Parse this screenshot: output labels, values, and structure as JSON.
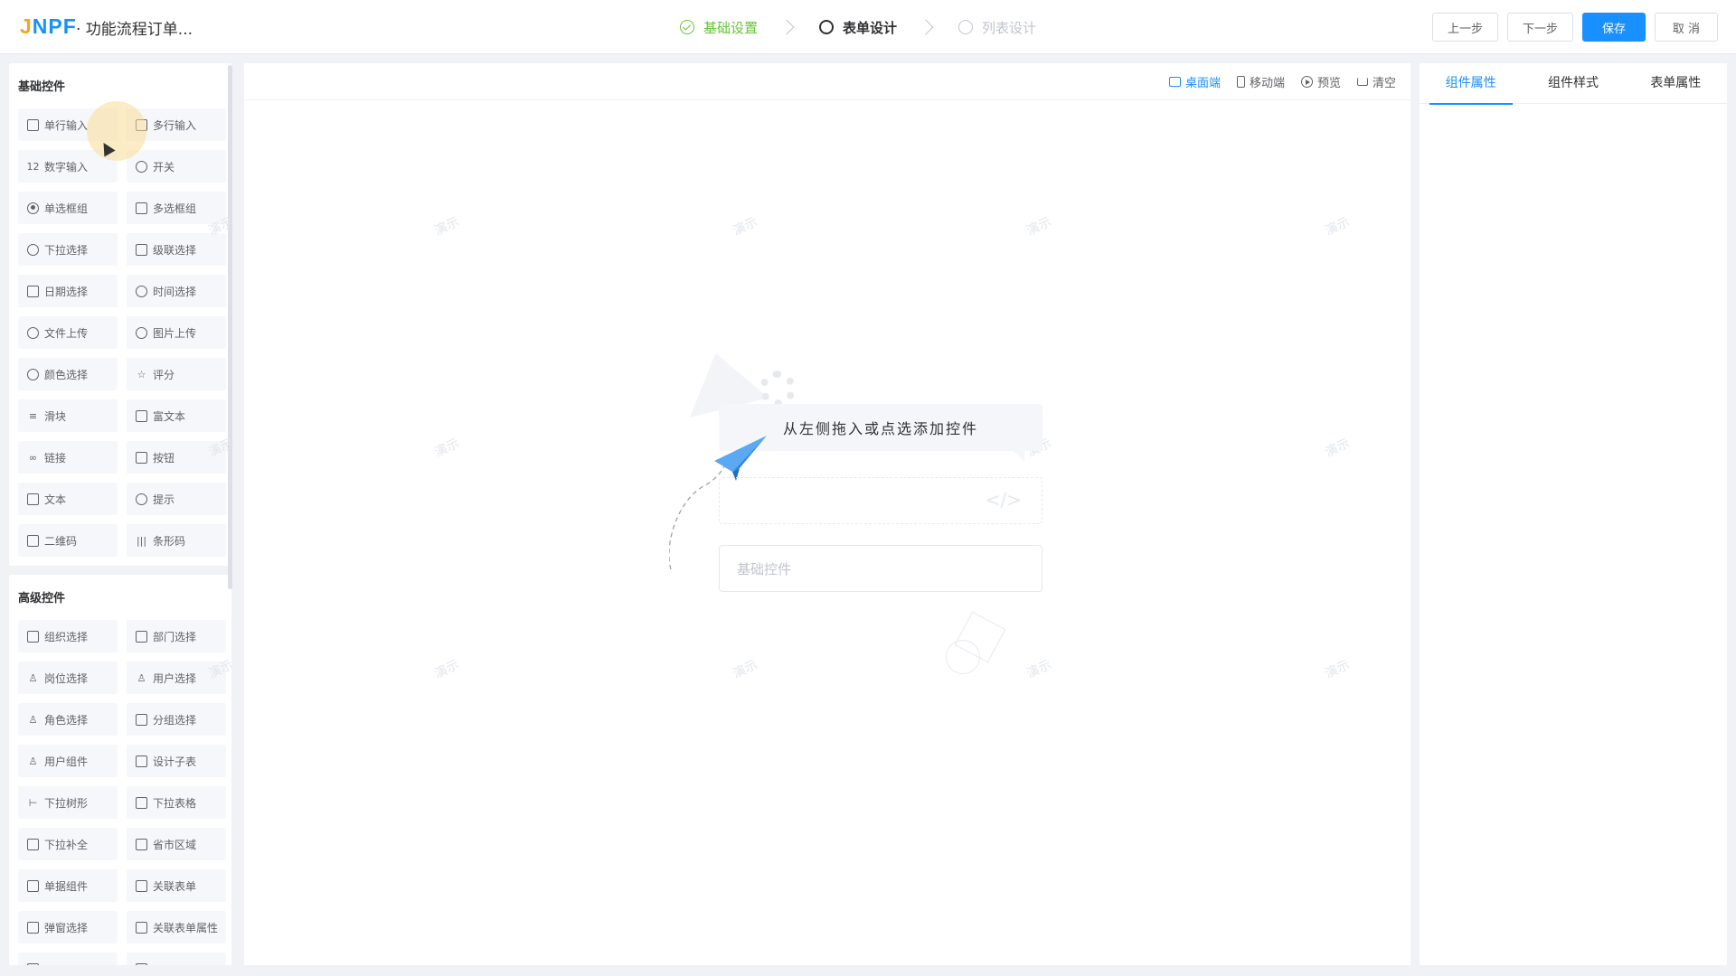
{
  "header": {
    "logo_a": "J",
    "logo_b": "NPF",
    "title": "· 功能流程订单...",
    "steps": [
      {
        "label": "基础设置",
        "state": "done"
      },
      {
        "label": "表单设计",
        "state": "active"
      },
      {
        "label": "列表设计",
        "state": "todo"
      }
    ],
    "buttons": {
      "prev": "上一步",
      "next": "下一步",
      "save": "保存",
      "cancel": "取 消"
    }
  },
  "basic": {
    "title": "基础控件",
    "items": [
      {
        "label": "单行输入",
        "icon": "input-icon"
      },
      {
        "label": "多行输入",
        "icon": "textarea-icon"
      },
      {
        "label": "数字输入",
        "icon": "number-icon"
      },
      {
        "label": "开关",
        "icon": "switch-icon"
      },
      {
        "label": "单选框组",
        "icon": "radio-icon"
      },
      {
        "label": "多选框组",
        "icon": "checkbox-icon"
      },
      {
        "label": "下拉选择",
        "icon": "select-icon"
      },
      {
        "label": "级联选择",
        "icon": "cascader-icon"
      },
      {
        "label": "日期选择",
        "icon": "calendar-icon"
      },
      {
        "label": "时间选择",
        "icon": "clock-icon"
      },
      {
        "label": "文件上传",
        "icon": "upload-icon"
      },
      {
        "label": "图片上传",
        "icon": "image-upload-icon"
      },
      {
        "label": "颜色选择",
        "icon": "palette-icon"
      },
      {
        "label": "评分",
        "icon": "star-icon"
      },
      {
        "label": "滑块",
        "icon": "slider-icon"
      },
      {
        "label": "富文本",
        "icon": "richtext-icon"
      },
      {
        "label": "链接",
        "icon": "link-icon"
      },
      {
        "label": "按钮",
        "icon": "button-icon"
      },
      {
        "label": "文本",
        "icon": "text-icon"
      },
      {
        "label": "提示",
        "icon": "info-icon"
      },
      {
        "label": "二维码",
        "icon": "qrcode-icon"
      },
      {
        "label": "条形码",
        "icon": "barcode-icon"
      }
    ]
  },
  "advanced": {
    "title": "高级控件",
    "items": [
      {
        "label": "组织选择",
        "icon": "org-icon"
      },
      {
        "label": "部门选择",
        "icon": "department-icon"
      },
      {
        "label": "岗位选择",
        "icon": "position-icon"
      },
      {
        "label": "用户选择",
        "icon": "user-icon"
      },
      {
        "label": "角色选择",
        "icon": "role-icon"
      },
      {
        "label": "分组选择",
        "icon": "group-icon"
      },
      {
        "label": "用户组件",
        "icon": "user-component-icon"
      },
      {
        "label": "设计子表",
        "icon": "table-icon"
      },
      {
        "label": "下拉树形",
        "icon": "tree-icon"
      },
      {
        "label": "下拉表格",
        "icon": "table-select-icon"
      },
      {
        "label": "下拉补全",
        "icon": "autocomplete-icon"
      },
      {
        "label": "省市区域",
        "icon": "area-icon"
      },
      {
        "label": "单据组件",
        "icon": "bill-icon"
      },
      {
        "label": "关联表单",
        "icon": "relation-form-icon"
      },
      {
        "label": "弹窗选择",
        "icon": "popup-icon"
      },
      {
        "label": "关联表单属性",
        "icon": "relation-attr-icon"
      },
      {
        "label": "",
        "icon": "more-icon"
      },
      {
        "label": "",
        "icon": "more-icon"
      }
    ]
  },
  "canvas": {
    "tools": [
      {
        "label": "桌面端",
        "active": true
      },
      {
        "label": "移动端",
        "active": false
      },
      {
        "label": "预览",
        "active": false
      },
      {
        "label": "清空",
        "active": false
      }
    ],
    "hint": "从左侧拖入或点选添加控件",
    "placeholder": "基础控件",
    "watermark": "演示",
    "code_glyph": "</>"
  },
  "right_tabs": [
    {
      "label": "组件属性",
      "active": true
    },
    {
      "label": "组件样式",
      "active": false
    },
    {
      "label": "表单属性",
      "active": false
    }
  ],
  "colors": {
    "primary": "#1890ff",
    "success": "#67c23a",
    "logo_accent": "#f5a623"
  }
}
